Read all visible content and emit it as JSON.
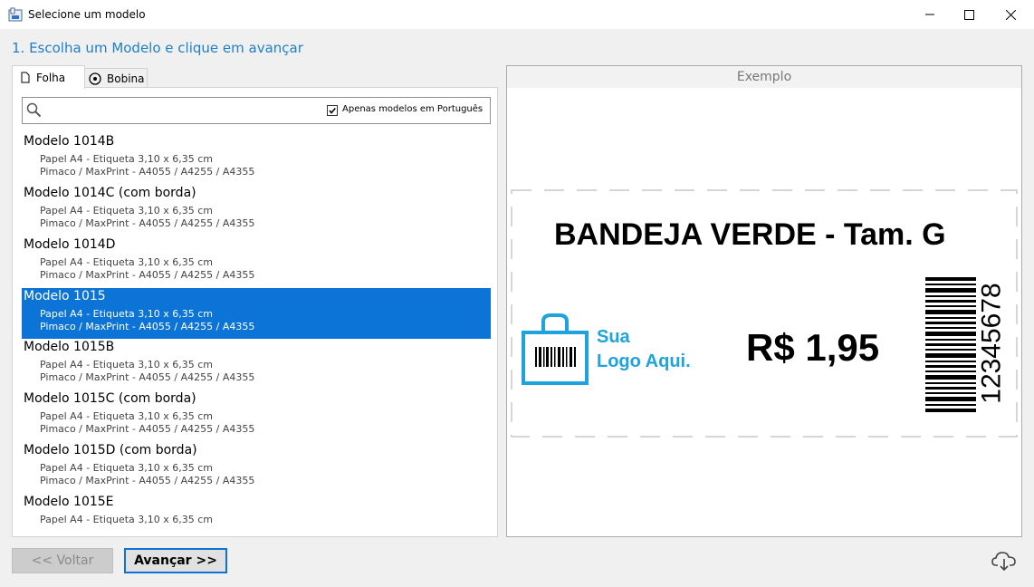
{
  "window": {
    "title": "Selecione um modelo"
  },
  "step_heading": "1. Escolha um Modelo e clique em avançar",
  "tabs": [
    {
      "label": "Folha",
      "icon": "page-icon",
      "active": true
    },
    {
      "label": "Bobina",
      "icon": "roll-icon",
      "active": false
    }
  ],
  "search": {
    "placeholder": "",
    "value": "",
    "filter_label": "Apenas modelos em Português",
    "filter_checked": true
  },
  "models": [
    {
      "name": "Modelo 1014B",
      "line1": "Papel A4 - Etiqueta 3,10 x 6,35 cm",
      "line2": "Pimaco / MaxPrint - A4055 / A4255 / A4355"
    },
    {
      "name": "Modelo 1014C (com borda)",
      "line1": "Papel A4 - Etiqueta 3,10 x 6,35 cm",
      "line2": "Pimaco / MaxPrint - A4055 / A4255 / A4355"
    },
    {
      "name": "Modelo 1014D",
      "line1": "Papel A4 - Etiqueta 3,10 x 6,35 cm",
      "line2": "Pimaco / MaxPrint - A4055 / A4255 / A4355"
    },
    {
      "name": "Modelo 1015",
      "line1": "Papel A4 - Etiqueta 3,10 x 6,35 cm",
      "line2": "Pimaco / MaxPrint - A4055 / A4255 / A4355",
      "selected": true
    },
    {
      "name": "Modelo 1015B",
      "line1": "Papel A4 - Etiqueta 3,10 x 6,35 cm",
      "line2": "Pimaco / MaxPrint - A4055 / A4255 / A4355"
    },
    {
      "name": "Modelo 1015C (com borda)",
      "line1": "Papel A4 - Etiqueta 3,10 x 6,35 cm",
      "line2": "Pimaco / MaxPrint - A4055 / A4255 / A4355"
    },
    {
      "name": "Modelo 1015D (com borda)",
      "line1": "Papel A4 - Etiqueta 3,10 x 6,35 cm",
      "line2": "Pimaco / MaxPrint - A4055 / A4255 / A4355"
    },
    {
      "name": "Modelo 1015E",
      "line1": "Papel A4 - Etiqueta 3,10 x 6,35 cm",
      "line2": ""
    }
  ],
  "preview": {
    "header": "Exemplo",
    "product_name": "BANDEJA VERDE - Tam. G",
    "price": "R$ 1,95",
    "logo_text": "Sua\nLogo Aqui.",
    "barcode_number": "12345678"
  },
  "buttons": {
    "back": "<< Voltar",
    "next": "Avançar >>"
  },
  "colors": {
    "accent": "#1f7fc9",
    "selection": "#0b74d6",
    "logo": "#1fa3dc"
  }
}
